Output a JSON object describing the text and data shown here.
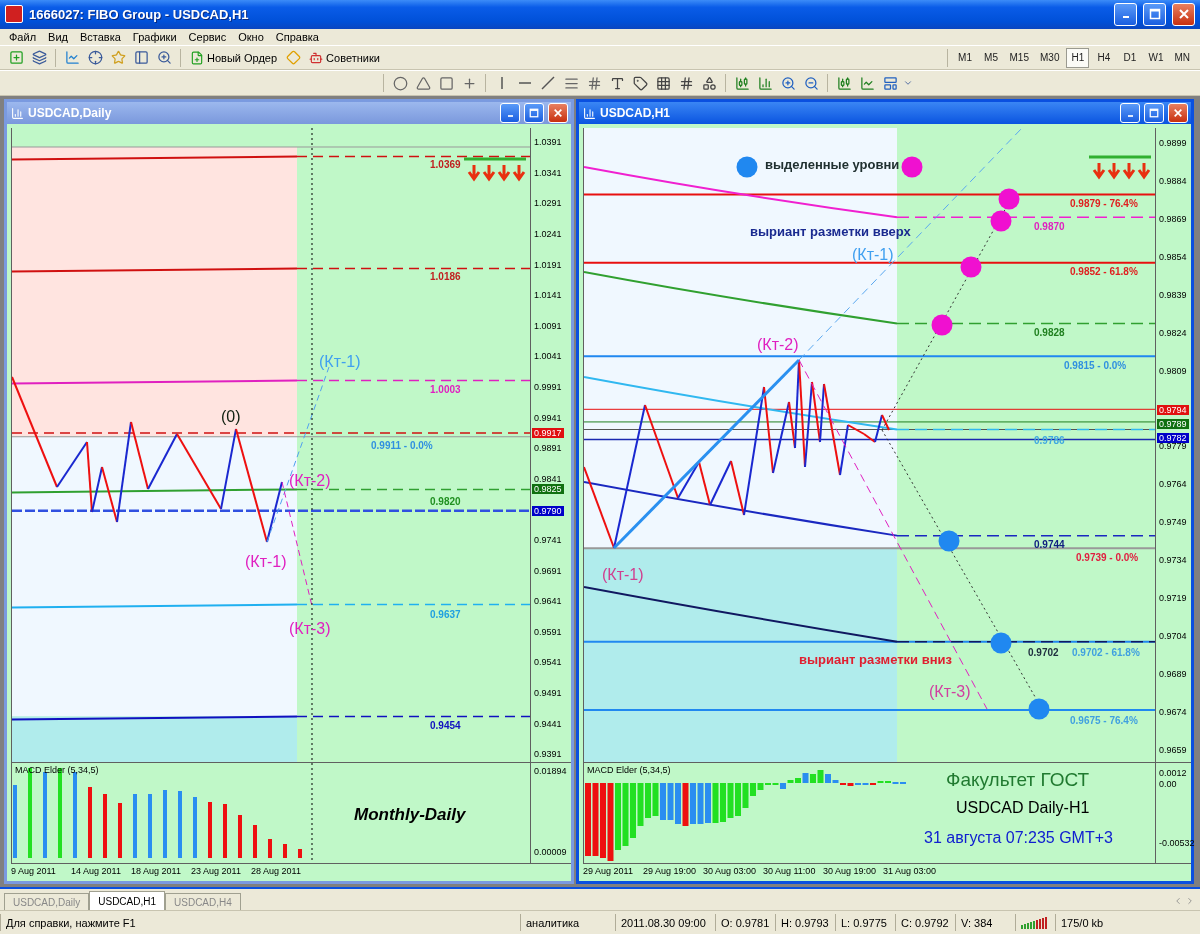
{
  "window": {
    "title": "1666027: FIBO Group - USDCAD,H1"
  },
  "menu": [
    "Файл",
    "Вид",
    "Вставка",
    "Графики",
    "Сервис",
    "Окно",
    "Справка"
  ],
  "toolbar_buttons": [
    "Новый Ордер",
    "Советники"
  ],
  "timeframes": [
    {
      "label": "M1",
      "selected": false
    },
    {
      "label": "M5",
      "selected": false
    },
    {
      "label": "M15",
      "selected": false
    },
    {
      "label": "M30",
      "selected": false
    },
    {
      "label": "H1",
      "selected": true
    },
    {
      "label": "H4",
      "selected": false
    },
    {
      "label": "D1",
      "selected": false
    },
    {
      "label": "W1",
      "selected": false
    },
    {
      "label": "MN",
      "selected": false
    }
  ],
  "charts": [
    {
      "title": "USDCAD,Daily",
      "active": false,
      "price_ticks": [
        "1.0391",
        "1.0341",
        "1.0291",
        "1.0241",
        "1.0191",
        "1.0141",
        "1.0091",
        "1.0041",
        "0.9991",
        "0.9941",
        "0.9891",
        "0.9841",
        "0.9741",
        "0.9691",
        "0.9641",
        "0.9591",
        "0.9541",
        "0.9491",
        "0.9441",
        "0.9391"
      ],
      "price_tags": [
        {
          "text": "0.9917",
          "color": "#e01010"
        },
        {
          "text": "0.9825",
          "color": "#107010"
        },
        {
          "text": "0.9790",
          "color": "#0000c8"
        }
      ],
      "level_labels": [
        {
          "text": "1.0369",
          "color": "#c02020"
        },
        {
          "text": "1.0186",
          "color": "#c02020"
        },
        {
          "text": "1.0003",
          "color": "#e020c0"
        },
        {
          "text": "0.9911 - 0.0%",
          "color": "#3090e0"
        },
        {
          "text": "0.9820",
          "color": "#209020"
        },
        {
          "text": "0.9637",
          "color": "#20a0e0"
        },
        {
          "text": "0.9454",
          "color": "#1010c0"
        }
      ],
      "annotations": [
        {
          "text": "(0)",
          "color": "#102010"
        },
        {
          "text": "(Кт-1)",
          "color": "#40a0f0"
        },
        {
          "text": "(Кт-2)",
          "color": "#e020c0"
        },
        {
          "text": "(Кт-1)",
          "color": "#e020c0"
        },
        {
          "text": "(Кт-3)",
          "color": "#e020c0"
        }
      ],
      "indicator": {
        "name": "MACD Elder (5,34,5)",
        "ticks": [
          "0.01894",
          "0.00009"
        ]
      },
      "captions": [
        {
          "text": "Monthly-Daily",
          "color": "#000000"
        }
      ],
      "time_ticks": [
        "9 Aug 2011",
        "14 Aug 2011",
        "18 Aug 2011",
        "23 Aug 2011",
        "28 Aug 2011"
      ]
    },
    {
      "title": "USDCAD,H1",
      "active": true,
      "price_ticks": [
        "0.9899",
        "0.9884",
        "0.9869",
        "0.9854",
        "0.9839",
        "0.9824",
        "0.9809",
        "0.9779",
        "0.9764",
        "0.9749",
        "0.9734",
        "0.9719",
        "0.9704",
        "0.9689",
        "0.9674",
        "0.9659"
      ],
      "price_tags": [
        {
          "text": "0.9794",
          "color": "#e01010"
        },
        {
          "text": "0.9789",
          "color": "#107010"
        },
        {
          "text": "0.9782",
          "color": "#0000c8"
        }
      ],
      "level_labels": [
        {
          "text": "0.9879 - 76.4%",
          "color": "#e02020"
        },
        {
          "text": "0.9870",
          "color": "#e020c0"
        },
        {
          "text": "0.9852 - 61.8%",
          "color": "#e02020"
        },
        {
          "text": "0.9828",
          "color": "#208020"
        },
        {
          "text": "0.9815 - 0.0%",
          "color": "#3090e0"
        },
        {
          "text": "0.9786",
          "color": "#40a8e0"
        },
        {
          "text": "0.9744",
          "color": "#102080"
        },
        {
          "text": "0.9739 - 0.0%",
          "color": "#e02040"
        },
        {
          "text": "0.9702",
          "color": "#203040"
        },
        {
          "text": "0.9702 - 61.8%",
          "color": "#40a0e0"
        },
        {
          "text": "0.9675 - 76.4%",
          "color": "#40a0e0"
        }
      ],
      "annotations": [
        {
          "text": "выделенные уровни",
          "color": "#203030"
        },
        {
          "text": "выриант разметки вверх",
          "color": "#1a2a90"
        },
        {
          "text": "(Кт-1)",
          "color": "#40a0f0"
        },
        {
          "text": "(Кт-2)",
          "color": "#e020c0"
        },
        {
          "text": "(Кт-1)",
          "color": "#d04090"
        },
        {
          "text": "выриант разметки вниз",
          "color": "#e02030"
        },
        {
          "text": "(Кт-3)",
          "color": "#d040a0"
        }
      ],
      "indicator": {
        "name": "MACD Elder (5,34,5)",
        "ticks": [
          "0.0012",
          "0.00",
          "-0.00532"
        ]
      },
      "captions": [
        {
          "text": "Факультет ГОСТ",
          "color": "#207a30"
        },
        {
          "text": "USDCAD Daily-H1",
          "color": "#000000"
        },
        {
          "text": "31 августа 07:235 GMT+3",
          "color": "#1020d0"
        }
      ],
      "time_ticks": [
        "29 Aug 2011",
        "29 Aug 19:00",
        "30 Aug 03:00",
        "30 Aug 11:00",
        "30 Aug 19:00",
        "31 Aug 03:00"
      ]
    }
  ],
  "chart_tabs": [
    {
      "label": "USDCAD,Daily",
      "selected": false
    },
    {
      "label": "USDCAD,H1",
      "selected": true
    },
    {
      "label": "USDCAD,H4",
      "selected": false
    }
  ],
  "status_bar": [
    "Для справки, нажмите F1",
    "аналитика",
    "2011.08.30 09:00",
    "O: 0.9781",
    "H: 0.9793",
    "L: 0.9775",
    "C: 0.9792",
    "V: 384",
    "175/0 kb"
  ]
}
